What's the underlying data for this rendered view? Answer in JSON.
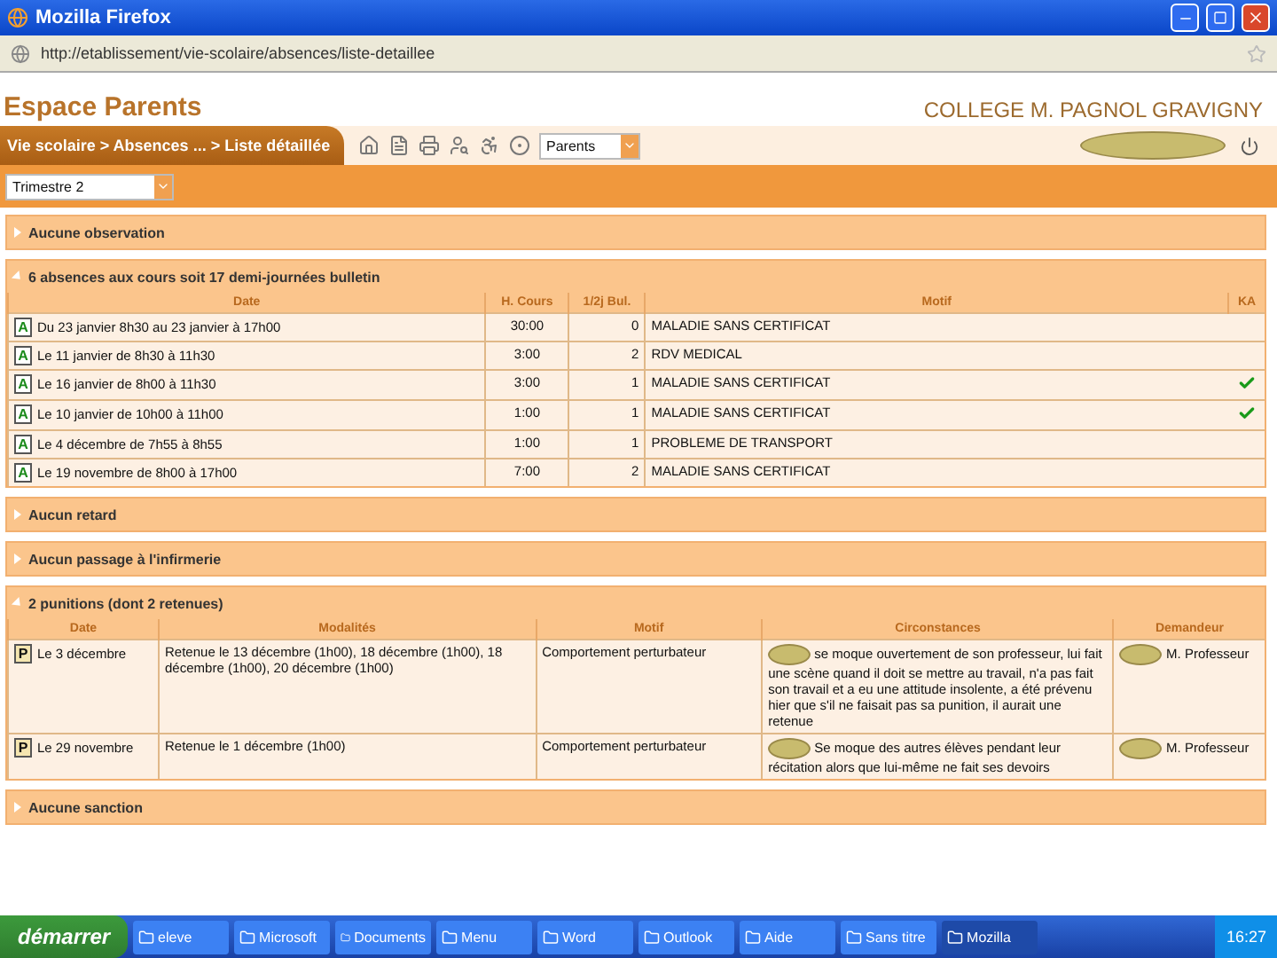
{
  "window": {
    "title": "Mozilla Firefox"
  },
  "address_bar": {
    "value": "http://etablissement/vie-scolaire/absences/liste-detaillee"
  },
  "header": {
    "title": "Espace Parents",
    "school": "COLLEGE M. PAGNOL GRAVIGNY"
  },
  "breadcrumb": "Vie scolaire > Absences ... > Liste détaillée",
  "toolbar_select": {
    "value": "Parents"
  },
  "period_select": {
    "value": "Trimestre 2"
  },
  "sections": [
    {
      "kind": "collapsed",
      "title": "Aucune observation",
      "expanded": false
    },
    {
      "kind": "absences",
      "title": "6 absences aux cours soit 17 demi-journées bulletin",
      "expanded": true,
      "columns": [
        "Date",
        "H. Cours",
        "1/2j Bul.",
        "Motif",
        "KA"
      ],
      "rows": [
        {
          "letter": "A",
          "date": "Du 23 janvier 8h30 au 23 janvier à 17h00",
          "hours": "30:00",
          "halfdays": "0",
          "reason": "MALADIE SANS CERTIFICAT",
          "checked": false
        },
        {
          "letter": "A",
          "date": "Le 11 janvier de 8h30 à 11h30",
          "hours": "3:00",
          "halfdays": "2",
          "reason": "RDV MEDICAL",
          "checked": false
        },
        {
          "letter": "A",
          "date": "Le 16 janvier de 8h00 à 11h30",
          "hours": "3:00",
          "halfdays": "1",
          "reason": "MALADIE SANS CERTIFICAT",
          "checked": true
        },
        {
          "letter": "A",
          "date": "Le 10 janvier de 10h00 à 11h00",
          "hours": "1:00",
          "halfdays": "1",
          "reason": "MALADIE SANS CERTIFICAT",
          "checked": true
        },
        {
          "letter": "A",
          "date": "Le 4 décembre de 7h55 à 8h55",
          "hours": "1:00",
          "halfdays": "1",
          "reason": "PROBLEME DE TRANSPORT",
          "checked": false
        },
        {
          "letter": "A",
          "date": "Le 19 novembre de 8h00 à 17h00",
          "hours": "7:00",
          "halfdays": "2",
          "reason": "MALADIE SANS CERTIFICAT",
          "checked": false
        }
      ]
    },
    {
      "kind": "collapsed",
      "title": "Aucun retard",
      "expanded": false
    },
    {
      "kind": "collapsed",
      "title": "Aucun passage à l'infirmerie",
      "expanded": false
    },
    {
      "kind": "punitions",
      "title": "2 punitions (dont 2 retenues)",
      "expanded": true,
      "columns": [
        "Date",
        "Modalités",
        "Motif",
        "Circonstances",
        "Demandeur"
      ],
      "rows": [
        {
          "letter": "P",
          "date": "Le 3 décembre",
          "terms": "Retenue le 13 décembre (1h00), 18 décembre (1h00), 18 décembre (1h00), 20 décembre (1h00)",
          "reason": "Comportement perturbateur",
          "circumstances": "se moque ouvertement de son professeur, lui fait une scène quand il doit se mettre au travail, n'a pas fait son travail et a eu une attitude insolente, a été prévenu hier que s'il ne faisait pas sa punition, il aurait une retenue",
          "requester": "M. Professeur"
        },
        {
          "letter": "P",
          "date": "Le 29 novembre",
          "terms": "Retenue le 1 décembre (1h00)",
          "reason": "Comportement perturbateur",
          "circumstances": "Se moque des autres élèves pendant leur récitation alors que lui-même ne fait ses devoirs",
          "requester": "M. Professeur"
        }
      ]
    },
    {
      "kind": "collapsed",
      "title": "Aucune sanction",
      "expanded": false
    }
  ],
  "taskbar": {
    "start": "démarrer",
    "tasks": [
      {
        "label": "eleve",
        "selected": false
      },
      {
        "label": "Microsoft",
        "selected": false
      },
      {
        "label": "Documents",
        "selected": false
      },
      {
        "label": "Menu",
        "selected": false
      },
      {
        "label": "Word",
        "selected": false
      },
      {
        "label": "Outlook",
        "selected": false
      },
      {
        "label": "Aide",
        "selected": false
      },
      {
        "label": "Sans titre",
        "selected": false
      },
      {
        "label": "Mozilla",
        "selected": true
      }
    ],
    "clock": "16:27"
  }
}
